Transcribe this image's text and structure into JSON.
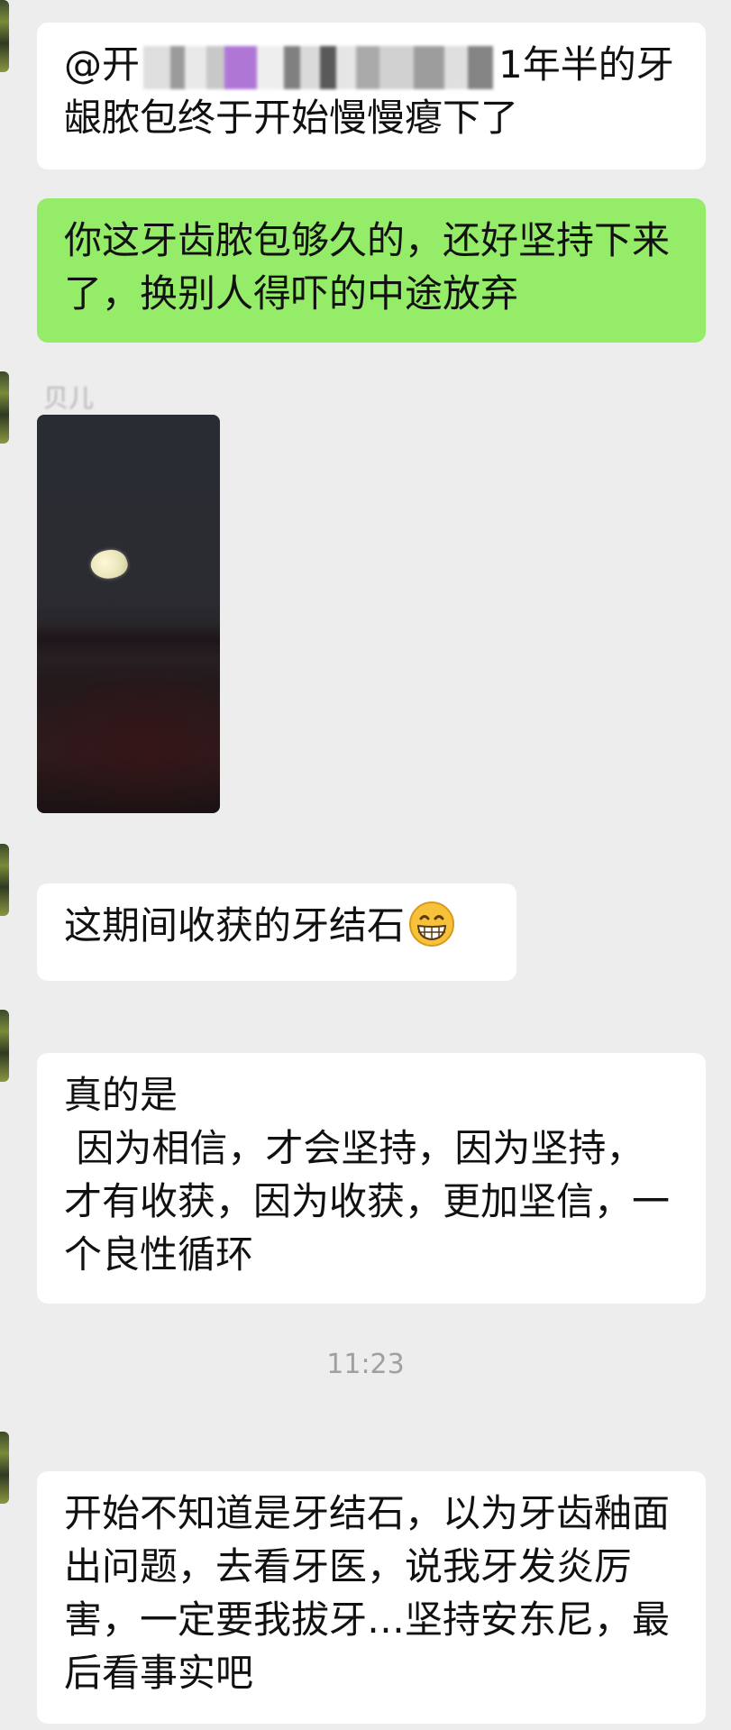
{
  "messages": [
    {
      "mention_prefix": "@开",
      "mention_tail": "",
      "text": "1年半的牙龈脓包终于开始慢慢瘪下了"
    },
    {
      "text": "你这牙齿脓包够久的，还好坚持下来了，换别人得吓的中途放弃"
    },
    {
      "sender_name": "贝儿"
    },
    {
      "text": "这期间收获的牙结石",
      "emoji": "grinning-face-icon"
    },
    {
      "text": "真的是\n 因为相信，才会坚持，因为坚持，才有收获，因为收获，更加坚信，一个良性循环"
    },
    {
      "text": "开始不知道是牙结石，以为牙齿釉面出问题，去看牙医，说我牙发炎厉害，一定要我拔牙…坚持安东尼，最后看事实吧"
    }
  ],
  "timestamp": "11:23",
  "colors": {
    "background": "#ededed",
    "incoming_bubble": "#ffffff",
    "outgoing_bubble": "#95ec69",
    "timestamp_text": "#a0a0a0"
  }
}
